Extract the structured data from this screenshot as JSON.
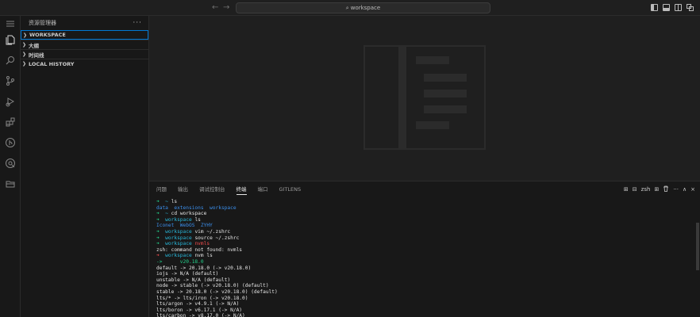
{
  "titlebar": {
    "back": "←",
    "forward": "→",
    "search_text": "workspace"
  },
  "sidebar": {
    "title": "资源管理器",
    "more": "···",
    "sections": [
      {
        "label": "WORKSPACE",
        "active": true
      },
      {
        "label": "大纲",
        "active": false
      },
      {
        "label": "时间线",
        "active": false
      },
      {
        "label": "LOCAL HISTORY",
        "active": false
      }
    ]
  },
  "panel": {
    "tabs": [
      "问题",
      "输出",
      "调试控制台",
      "终端",
      "端口",
      "GITLENS"
    ],
    "active_tab": "终端",
    "shell": "zsh",
    "actions": {
      "split": "⊞",
      "shell_icon": "⊟",
      "trash": "🗑",
      "more": "···",
      "up": "∧",
      "close": "×"
    }
  },
  "terminal": {
    "lines": [
      {
        "segs": [
          {
            "t": "➜ ",
            "c": "g bold"
          },
          {
            "t": " ~ ",
            "c": "c"
          },
          {
            "t": "ls",
            "c": "w"
          }
        ]
      },
      {
        "segs": [
          {
            "t": "data  extensions  workspace",
            "c": "b"
          }
        ]
      },
      {
        "segs": [
          {
            "t": "➜ ",
            "c": "g bold"
          },
          {
            "t": " ~ ",
            "c": "c"
          },
          {
            "t": "cd workspace",
            "c": "w"
          }
        ]
      },
      {
        "segs": [
          {
            "t": "➜ ",
            "c": "g bold"
          },
          {
            "t": " workspace ",
            "c": "c"
          },
          {
            "t": "ls",
            "c": "w"
          }
        ]
      },
      {
        "segs": [
          {
            "t": "Iconet  WebOS  ZYHY",
            "c": "b"
          }
        ]
      },
      {
        "segs": [
          {
            "t": "➜ ",
            "c": "g bold"
          },
          {
            "t": " workspace ",
            "c": "c"
          },
          {
            "t": "vim ~/.zshrc",
            "c": "w"
          }
        ]
      },
      {
        "segs": [
          {
            "t": "➜ ",
            "c": "g bold"
          },
          {
            "t": " workspace ",
            "c": "c"
          },
          {
            "t": "source ~/.zshrc",
            "c": "w"
          }
        ]
      },
      {
        "segs": [
          {
            "t": "➜ ",
            "c": "g bold"
          },
          {
            "t": " workspace ",
            "c": "c"
          },
          {
            "t": "nvmls",
            "c": "r"
          }
        ]
      },
      {
        "segs": [
          {
            "t": "zsh: command not found: nvmls",
            "c": "w"
          }
        ]
      },
      {
        "segs": [
          {
            "t": "➜ ",
            "c": "r bold"
          },
          {
            "t": " workspace ",
            "c": "c"
          },
          {
            "t": "nvm ls",
            "c": "w"
          }
        ]
      },
      {
        "segs": [
          {
            "t": "->      v20.18.0",
            "c": "g"
          }
        ]
      },
      {
        "segs": [
          {
            "t": "default -> 20.18.0 (-> v20.18.0)",
            "c": "w"
          }
        ]
      },
      {
        "segs": [
          {
            "t": "iojs -> N/A (default)",
            "c": "w"
          }
        ]
      },
      {
        "segs": [
          {
            "t": "unstable -> N/A (default)",
            "c": "w"
          }
        ]
      },
      {
        "segs": [
          {
            "t": "node -> stable (-> v20.18.0) (default)",
            "c": "w"
          }
        ]
      },
      {
        "segs": [
          {
            "t": "stable -> 20.18.0 (-> v20.18.0) (default)",
            "c": "w"
          }
        ]
      },
      {
        "segs": [
          {
            "t": "lts/* -> lts/iron (-> v20.18.0)",
            "c": "w"
          }
        ]
      },
      {
        "segs": [
          {
            "t": "lts/argon -> v4.9.1 (-> N/A)",
            "c": "w"
          }
        ]
      },
      {
        "segs": [
          {
            "t": "lts/boron -> v6.17.1 (-> N/A)",
            "c": "w"
          }
        ]
      },
      {
        "segs": [
          {
            "t": "lts/carbon -> v8.17.0 (-> N/A)",
            "c": "w"
          }
        ]
      }
    ]
  },
  "colors": {
    "accent": "#0078d4",
    "terminal_green": "#23d18b",
    "terminal_red": "#f14c4c",
    "terminal_cyan": "#29b8db",
    "terminal_blue": "#3b8eea"
  }
}
